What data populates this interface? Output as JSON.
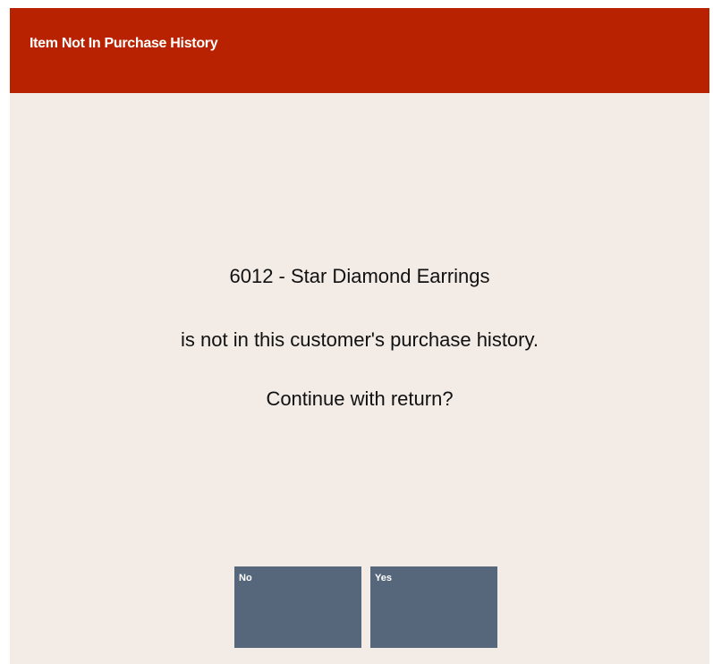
{
  "dialog": {
    "title": "Item Not In Purchase History",
    "message": {
      "item": "6012 - Star Diamond Earrings",
      "detail": "is not in this customer's purchase history.",
      "prompt": "Continue with return?"
    },
    "buttons": {
      "no": "No",
      "yes": "Yes"
    }
  },
  "colors": {
    "title_bar": "#b82200",
    "background": "#f2ebe6",
    "button": "#56677c"
  }
}
